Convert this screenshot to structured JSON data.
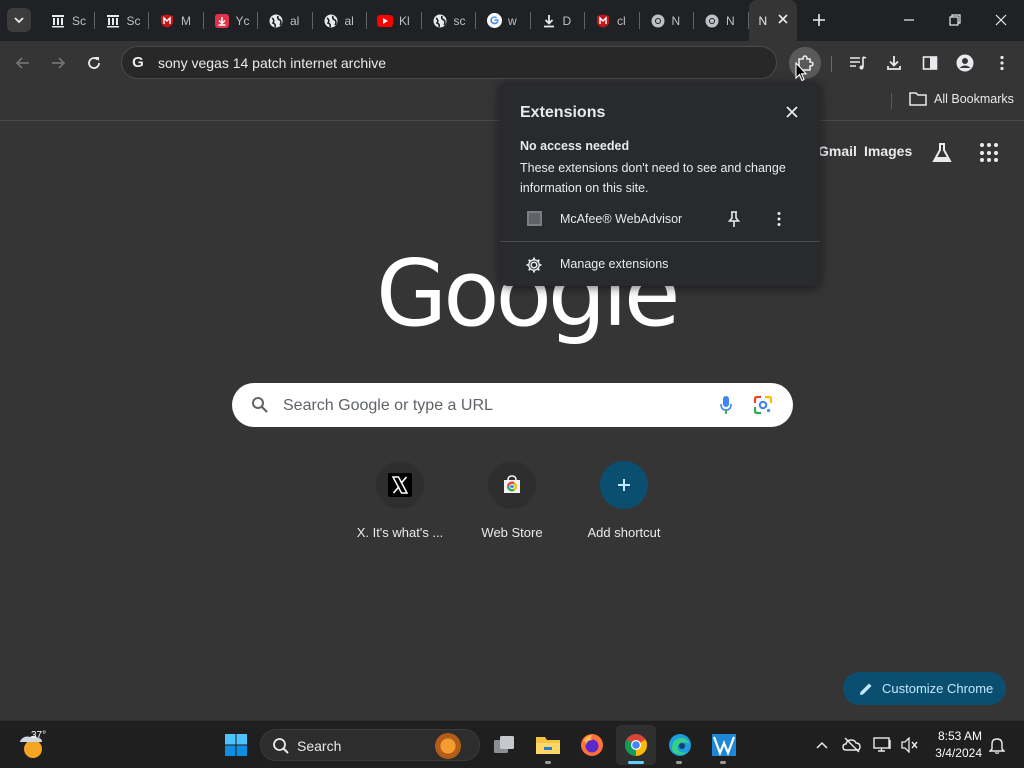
{
  "tabs": [
    {
      "icon": "archive-icon",
      "title": "Sc"
    },
    {
      "icon": "archive-icon",
      "title": "Sc"
    },
    {
      "icon": "mcafee-icon",
      "title": "M"
    },
    {
      "icon": "download-red-icon",
      "title": "Yc"
    },
    {
      "icon": "globe-icon",
      "title": "al"
    },
    {
      "icon": "globe-icon",
      "title": "al"
    },
    {
      "icon": "youtube-icon",
      "title": "Kl"
    },
    {
      "icon": "globe-icon",
      "title": "sc"
    },
    {
      "icon": "google-icon",
      "title": "w"
    },
    {
      "icon": "download-icon",
      "title": "D"
    },
    {
      "icon": "mcafee-icon",
      "title": "cl"
    },
    {
      "icon": "chrome-icon",
      "title": "N"
    },
    {
      "icon": "chrome-icon",
      "title": "N"
    }
  ],
  "active_tab": {
    "title": "N"
  },
  "omnibox": {
    "text": "sony vegas 14 patch internet archive"
  },
  "bookmarks": {
    "all_label": "All Bookmarks"
  },
  "ntp": {
    "gmail": "Gmail",
    "images": "Images",
    "logo": "Google",
    "search_placeholder": "Search Google or type a URL",
    "shortcuts": [
      {
        "label": "X. It's what's ...",
        "icon": "x-logo-icon"
      },
      {
        "label": "Web Store",
        "icon": "web-store-icon"
      },
      {
        "label": "Add shortcut",
        "icon": "plus-icon"
      }
    ],
    "customize_label": "Customize Chrome"
  },
  "extensions_popup": {
    "title": "Extensions",
    "section_title": "No access needed",
    "section_desc": "These extensions don't need to see and change information on this site.",
    "items": [
      {
        "name": "McAfee® WebAdvisor"
      }
    ],
    "manage_label": "Manage extensions"
  },
  "taskbar": {
    "weather_temp": "37°",
    "search_label": "Search",
    "time": "8:53 AM",
    "date": "3/4/2024"
  },
  "colors": {
    "accent": "#0b4f70",
    "accent_text": "#c2e7ff",
    "background": "#353535",
    "tabstrip": "#202124"
  }
}
